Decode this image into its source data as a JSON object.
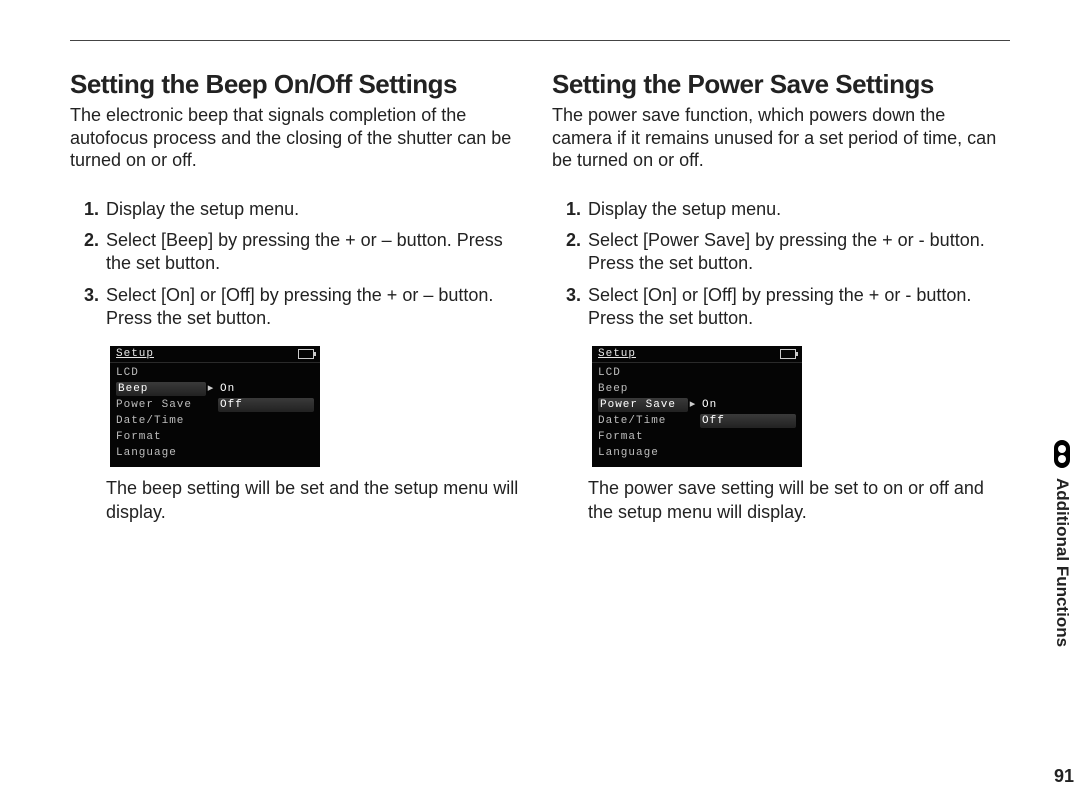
{
  "page_number": "91",
  "side_tab": "Additional Functions",
  "left": {
    "heading": "Setting the Beep On/Off Settings",
    "intro": "The electronic beep that signals completion of the autofocus process and the closing of the shutter can be turned on or off.",
    "steps": [
      "Display the setup menu.",
      "Select [Beep] by pressing the + or – button. Press the set button.",
      "Select [On] or [Off] by pressing the + or – button. Press the set button."
    ],
    "menu": {
      "title": "Setup",
      "rows": [
        {
          "label": "LCD",
          "val": "",
          "hl": ""
        },
        {
          "label": "Beep",
          "val": "On",
          "hl": "label"
        },
        {
          "label": "Power Save",
          "val": "Off",
          "hl": "val"
        },
        {
          "label": "Date/Time",
          "val": "",
          "hl": ""
        },
        {
          "label": "Format",
          "val": "",
          "hl": ""
        },
        {
          "label": "Language",
          "val": "",
          "hl": ""
        }
      ]
    },
    "result": "The beep setting will be set and the setup menu will display."
  },
  "right": {
    "heading": "Setting the Power Save Settings",
    "intro": "The power save function, which powers down the camera if it remains unused for a set period of time, can be turned on or off.",
    "steps": [
      "Display the setup menu.",
      "Select [Power Save] by pressing the + or - button. Press the set button.",
      "Select [On] or [Off] by pressing the + or - button. Press the set button."
    ],
    "menu": {
      "title": "Setup",
      "rows": [
        {
          "label": "LCD",
          "val": "",
          "hl": ""
        },
        {
          "label": "Beep",
          "val": "",
          "hl": ""
        },
        {
          "label": "Power Save",
          "val": "On",
          "hl": "label"
        },
        {
          "label": "Date/Time",
          "val": "Off",
          "hl": "val"
        },
        {
          "label": "Format",
          "val": "",
          "hl": ""
        },
        {
          "label": "Language",
          "val": "",
          "hl": ""
        }
      ]
    },
    "result": "The power save setting will be set to on or off and the setup menu will display."
  }
}
